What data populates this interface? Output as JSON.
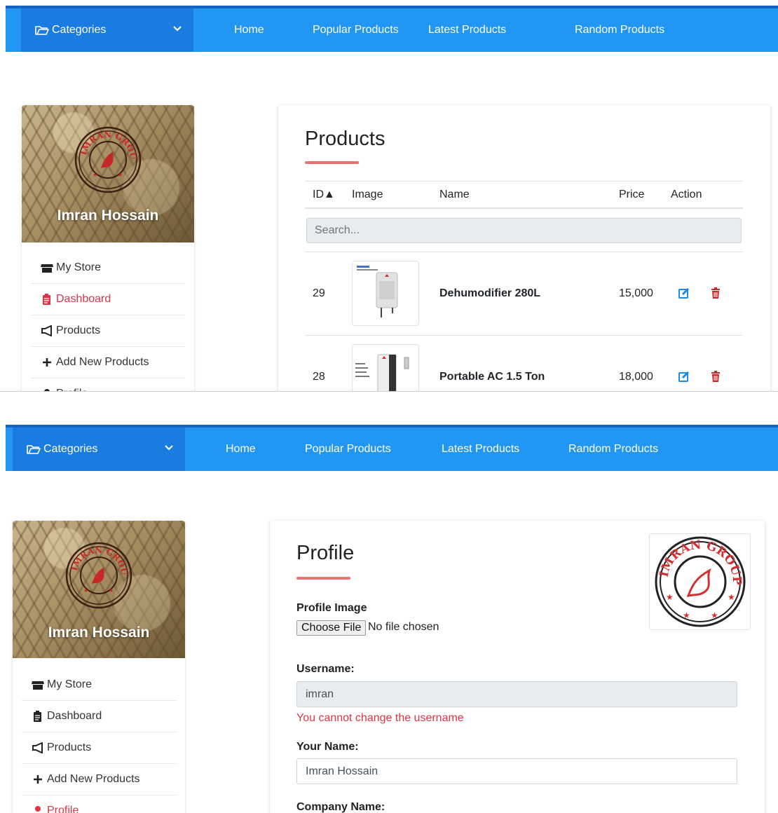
{
  "nav": {
    "categories_label": "Categories",
    "links": [
      "Home",
      "Popular Products",
      "Latest Products",
      "Random Products"
    ]
  },
  "sidebar": {
    "user_name": "Imran Hossain",
    "seal_text": "IMRAN GROUP",
    "items": [
      {
        "label": "My Store",
        "icon": "store-icon"
      },
      {
        "label": "Dashboard",
        "icon": "clipboard-icon"
      },
      {
        "label": "Products",
        "icon": "megaphone-icon"
      },
      {
        "label": "Add New Products",
        "icon": "plus-icon"
      },
      {
        "label": "Profile",
        "icon": "user-icon"
      }
    ]
  },
  "products_page": {
    "title": "Products",
    "columns": {
      "id": "ID▲",
      "image": "Image",
      "name": "Name",
      "price": "Price",
      "action": "Action"
    },
    "search_placeholder": "Search...",
    "rows": [
      {
        "id": "29",
        "name": "Dehumodifier 280L",
        "price": "15,000"
      },
      {
        "id": "28",
        "name": "Portable AC 1.5 Ton",
        "price": "18,000"
      }
    ]
  },
  "profile_page": {
    "title": "Profile",
    "profile_image_label": "Profile Image",
    "choose_file_label": "Choose File",
    "file_status": "No file chosen",
    "username_label": "Username:",
    "username_value": "imran",
    "username_hint": "You cannot change the username",
    "your_name_label": "Your Name:",
    "your_name_value": "Imran Hossain",
    "company_name_label": "Company Name:"
  },
  "colors": {
    "nav": "#2196f3",
    "nav_dark": "#1a7ce0",
    "accent_red": "#dc3545",
    "edit_blue": "#1e88e5",
    "underline": "#e57373"
  }
}
